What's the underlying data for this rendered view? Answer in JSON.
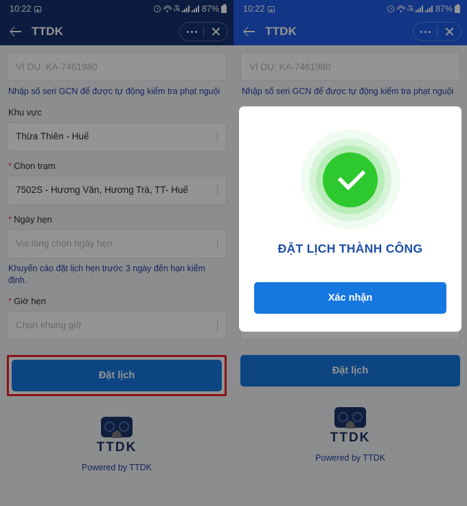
{
  "colors": {
    "header_active": "#1f5ce6",
    "header_dimmed": "#15316f",
    "primary_button": "#1677e0",
    "success_green": "#2ec92e",
    "link_blue": "#2340a0",
    "annotation_red": "#e8242b",
    "page_bg": "#f2f3f5"
  },
  "statusbar": {
    "time": "10:22",
    "battery_percent": "87%",
    "volte_label": "VoLTE",
    "icons": [
      "photo-icon",
      "alarm-icon",
      "wifi-icon",
      "volte-icon",
      "signal-icon",
      "signal-icon",
      "battery-icon"
    ]
  },
  "header": {
    "title": "TTDK",
    "back_icon": "back-arrow-icon",
    "more_icon": "more-options-icon",
    "close_icon": "close-icon"
  },
  "form": {
    "serial_input": {
      "placeholder": "VÍ DỤ: KA-7461980",
      "value": ""
    },
    "serial_hint": "Nhập số seri GCN để được tự động kiểm tra phạt nguội",
    "area": {
      "label": "Khu vực",
      "value": "Thừa Thiên - Huế",
      "required": false
    },
    "station": {
      "label": "Chọn trạm",
      "value": "7502S - Hương Vân, Hương Trà, TT- Huế",
      "required": true
    },
    "date": {
      "label": "Ngày hẹn",
      "placeholder": "Vui lòng chọn ngày hẹn",
      "value": "",
      "required": true
    },
    "date_hint": "Khuyến cáo đặt lịch hẹn trước 3 ngày đến hạn kiểm định.",
    "time": {
      "label": "Giờ hẹn",
      "placeholder": "Chọn khung giờ",
      "value": "",
      "required": true
    },
    "submit_label": "Đặt lịch",
    "required_marker": "*"
  },
  "footer": {
    "logo_icon": "ttdk-goggles-logo",
    "logo_text": "TTDK",
    "powered_by": "Powered by TTDK"
  },
  "modal": {
    "success_icon": "green-check-circle-icon",
    "title": "ĐẶT LỊCH THÀNH CÔNG",
    "confirm_label": "Xác nhận"
  }
}
